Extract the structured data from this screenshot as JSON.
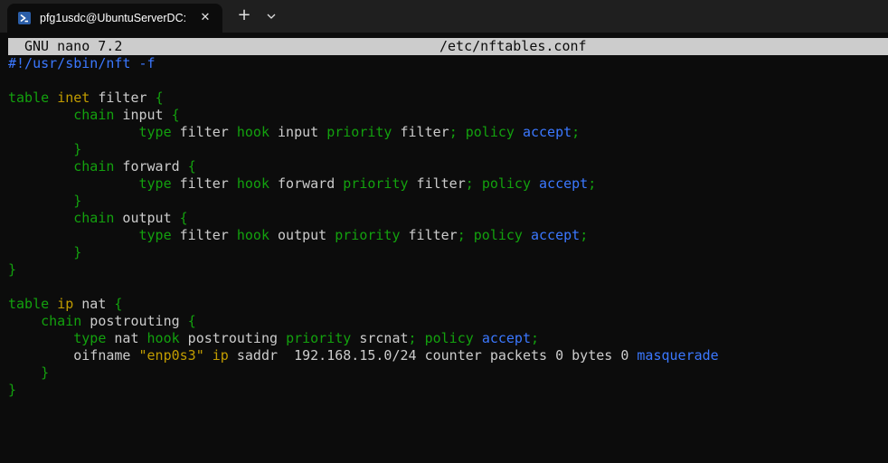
{
  "window": {
    "tab_title": "pfg1usdc@UbuntuServerDC: ~",
    "tab_icon": "powershell-icon",
    "close_icon": "close-icon",
    "new_tab_icon": "plus-icon",
    "dropdown_icon": "chevron-down-icon"
  },
  "nano": {
    "version": "GNU nano 7.2",
    "filename": "/etc/nftables.conf"
  },
  "colors": {
    "background": "#0c0c0c",
    "foreground": "#cccccc",
    "keyword": "#13a10e",
    "family": "#c19c00",
    "verdict": "#3b78ff",
    "header_bg": "#cccccc"
  },
  "code_lines": [
    [
      {
        "t": "#!/usr/sbin/nft -f",
        "c": "comment"
      }
    ],
    [],
    [
      {
        "t": "table",
        "c": "kw"
      },
      {
        "t": " ",
        "c": "text"
      },
      {
        "t": "inet",
        "c": "fam"
      },
      {
        "t": " filter ",
        "c": "text"
      },
      {
        "t": "{",
        "c": "punct"
      }
    ],
    [
      {
        "t": "        ",
        "c": "text"
      },
      {
        "t": "chain",
        "c": "kw"
      },
      {
        "t": " input ",
        "c": "text"
      },
      {
        "t": "{",
        "c": "punct"
      }
    ],
    [
      {
        "t": "                ",
        "c": "text"
      },
      {
        "t": "type",
        "c": "kw"
      },
      {
        "t": " filter ",
        "c": "text"
      },
      {
        "t": "hook",
        "c": "kw"
      },
      {
        "t": " input ",
        "c": "text"
      },
      {
        "t": "priority",
        "c": "kw"
      },
      {
        "t": " filter",
        "c": "text"
      },
      {
        "t": ";",
        "c": "punct"
      },
      {
        "t": " ",
        "c": "text"
      },
      {
        "t": "policy",
        "c": "kw"
      },
      {
        "t": " ",
        "c": "text"
      },
      {
        "t": "accept",
        "c": "verdict"
      },
      {
        "t": ";",
        "c": "punct"
      }
    ],
    [
      {
        "t": "        ",
        "c": "text"
      },
      {
        "t": "}",
        "c": "punct"
      }
    ],
    [
      {
        "t": "        ",
        "c": "text"
      },
      {
        "t": "chain",
        "c": "kw"
      },
      {
        "t": " forward ",
        "c": "text"
      },
      {
        "t": "{",
        "c": "punct"
      }
    ],
    [
      {
        "t": "                ",
        "c": "text"
      },
      {
        "t": "type",
        "c": "kw"
      },
      {
        "t": " filter ",
        "c": "text"
      },
      {
        "t": "hook",
        "c": "kw"
      },
      {
        "t": " forward ",
        "c": "text"
      },
      {
        "t": "priority",
        "c": "kw"
      },
      {
        "t": " filter",
        "c": "text"
      },
      {
        "t": ";",
        "c": "punct"
      },
      {
        "t": " ",
        "c": "text"
      },
      {
        "t": "policy",
        "c": "kw"
      },
      {
        "t": " ",
        "c": "text"
      },
      {
        "t": "accept",
        "c": "verdict"
      },
      {
        "t": ";",
        "c": "punct"
      }
    ],
    [
      {
        "t": "        ",
        "c": "text"
      },
      {
        "t": "}",
        "c": "punct"
      }
    ],
    [
      {
        "t": "        ",
        "c": "text"
      },
      {
        "t": "chain",
        "c": "kw"
      },
      {
        "t": " output ",
        "c": "text"
      },
      {
        "t": "{",
        "c": "punct"
      }
    ],
    [
      {
        "t": "                ",
        "c": "text"
      },
      {
        "t": "type",
        "c": "kw"
      },
      {
        "t": " filter ",
        "c": "text"
      },
      {
        "t": "hook",
        "c": "kw"
      },
      {
        "t": " output ",
        "c": "text"
      },
      {
        "t": "priority",
        "c": "kw"
      },
      {
        "t": " filter",
        "c": "text"
      },
      {
        "t": ";",
        "c": "punct"
      },
      {
        "t": " ",
        "c": "text"
      },
      {
        "t": "policy",
        "c": "kw"
      },
      {
        "t": " ",
        "c": "text"
      },
      {
        "t": "accept",
        "c": "verdict"
      },
      {
        "t": ";",
        "c": "punct"
      }
    ],
    [
      {
        "t": "        ",
        "c": "text"
      },
      {
        "t": "}",
        "c": "punct"
      }
    ],
    [
      {
        "t": "}",
        "c": "punct"
      }
    ],
    [],
    [
      {
        "t": "table",
        "c": "kw"
      },
      {
        "t": " ",
        "c": "text"
      },
      {
        "t": "ip",
        "c": "fam"
      },
      {
        "t": " nat ",
        "c": "text"
      },
      {
        "t": "{",
        "c": "punct"
      }
    ],
    [
      {
        "t": "    ",
        "c": "text"
      },
      {
        "t": "chain",
        "c": "kw"
      },
      {
        "t": " postrouting ",
        "c": "text"
      },
      {
        "t": "{",
        "c": "punct"
      }
    ],
    [
      {
        "t": "        ",
        "c": "text"
      },
      {
        "t": "type",
        "c": "kw"
      },
      {
        "t": " nat ",
        "c": "text"
      },
      {
        "t": "hook",
        "c": "kw"
      },
      {
        "t": " postrouting ",
        "c": "text"
      },
      {
        "t": "priority",
        "c": "kw"
      },
      {
        "t": " srcnat",
        "c": "text"
      },
      {
        "t": ";",
        "c": "punct"
      },
      {
        "t": " ",
        "c": "text"
      },
      {
        "t": "policy",
        "c": "kw"
      },
      {
        "t": " ",
        "c": "text"
      },
      {
        "t": "accept",
        "c": "verdict"
      },
      {
        "t": ";",
        "c": "punct"
      }
    ],
    [
      {
        "t": "        oifname ",
        "c": "text"
      },
      {
        "t": "\"enp0s3\"",
        "c": "string"
      },
      {
        "t": " ",
        "c": "text"
      },
      {
        "t": "ip",
        "c": "fam"
      },
      {
        "t": " saddr  192.168.15.0/24 counter packets 0 bytes 0 ",
        "c": "text"
      },
      {
        "t": "masquerade",
        "c": "verdict"
      }
    ],
    [
      {
        "t": "    ",
        "c": "text"
      },
      {
        "t": "}",
        "c": "punct"
      }
    ],
    [
      {
        "t": "}",
        "c": "punct"
      }
    ]
  ]
}
